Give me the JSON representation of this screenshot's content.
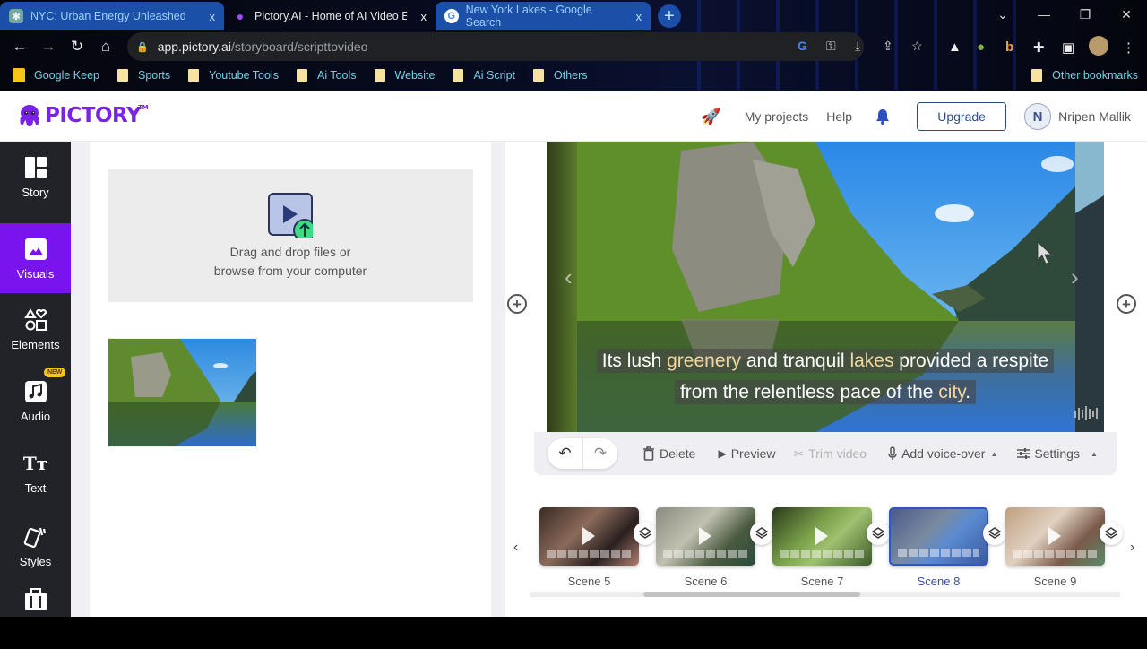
{
  "browser": {
    "tabs": [
      {
        "title": "NYC: Urban Energy Unleashed",
        "icon": "chatgpt-icon",
        "active": false
      },
      {
        "title": "Pictory.AI - Home of AI Video Ed",
        "icon": "pictory-octopus-icon",
        "active": true
      },
      {
        "title": "New York Lakes - Google Search",
        "icon": "google-icon",
        "active": false
      }
    ],
    "new_tab_label": "+",
    "url_host": "app.pictory.ai",
    "url_path": "/storyboard/scripttovideo",
    "bookmarks": [
      {
        "label": "Google Keep",
        "icon": "keep-icon"
      },
      {
        "label": "Sports",
        "icon": "folder-icon"
      },
      {
        "label": "Youtube Tools",
        "icon": "folder-icon"
      },
      {
        "label": "Ai Tools",
        "icon": "folder-icon"
      },
      {
        "label": "Website",
        "icon": "folder-icon"
      },
      {
        "label": "Ai Script",
        "icon": "folder-icon"
      },
      {
        "label": "Others",
        "icon": "folder-icon"
      }
    ],
    "other_bookmarks": "Other bookmarks",
    "close_glyph": "x"
  },
  "header": {
    "brand": "PICTORY",
    "trademark": "TM",
    "my_projects": "My projects",
    "help": "Help",
    "upgrade": "Upgrade",
    "user_initial": "N",
    "user_name": "Nripen Mallik"
  },
  "sidebar": {
    "items": [
      {
        "label": "Story",
        "icon": "story-layout-icon",
        "active": false
      },
      {
        "label": "Visuals",
        "icon": "image-icon",
        "active": true
      },
      {
        "label": "Elements",
        "icon": "shapes-icon",
        "active": false
      },
      {
        "label": "Audio",
        "icon": "music-note-icon",
        "active": false,
        "badge": "NEW"
      },
      {
        "label": "Text",
        "icon": "text-size-icon",
        "active": false
      },
      {
        "label": "Styles",
        "icon": "styles-cards-icon",
        "active": false
      },
      {
        "label": "",
        "icon": "briefcase-icon",
        "active": false
      }
    ]
  },
  "upload": {
    "line1": "Drag and drop files or",
    "line2": "browse from your computer"
  },
  "preview": {
    "caption_line1": [
      {
        "text": "Its lush ",
        "highlight": false
      },
      {
        "text": "greenery",
        "highlight": true
      },
      {
        "text": " and tranquil ",
        "highlight": false
      },
      {
        "text": "lakes",
        "highlight": true
      },
      {
        "text": " provided a respite",
        "highlight": false
      }
    ],
    "caption_line2": [
      {
        "text": "from the relentless pace of the ",
        "highlight": false
      },
      {
        "text": "city",
        "highlight": true
      },
      {
        "text": ".",
        "highlight": false
      }
    ],
    "highlight_color": "#f3d79a"
  },
  "controls": {
    "delete": "Delete",
    "preview": "Preview",
    "trim_video": "Trim video",
    "add_voice_over": "Add voice-over",
    "settings": "Settings"
  },
  "scenes": [
    {
      "label": "Scene 5",
      "selected": false
    },
    {
      "label": "Scene 6",
      "selected": false
    },
    {
      "label": "Scene 7",
      "selected": false
    },
    {
      "label": "Scene 8",
      "selected": true
    },
    {
      "label": "Scene 9",
      "selected": false
    }
  ],
  "colors": {
    "brand_purple": "#7a14ee",
    "sidebar_bg": "#222329",
    "selected_scene": "#2f55c8",
    "new_badge": "#f6c51b"
  }
}
